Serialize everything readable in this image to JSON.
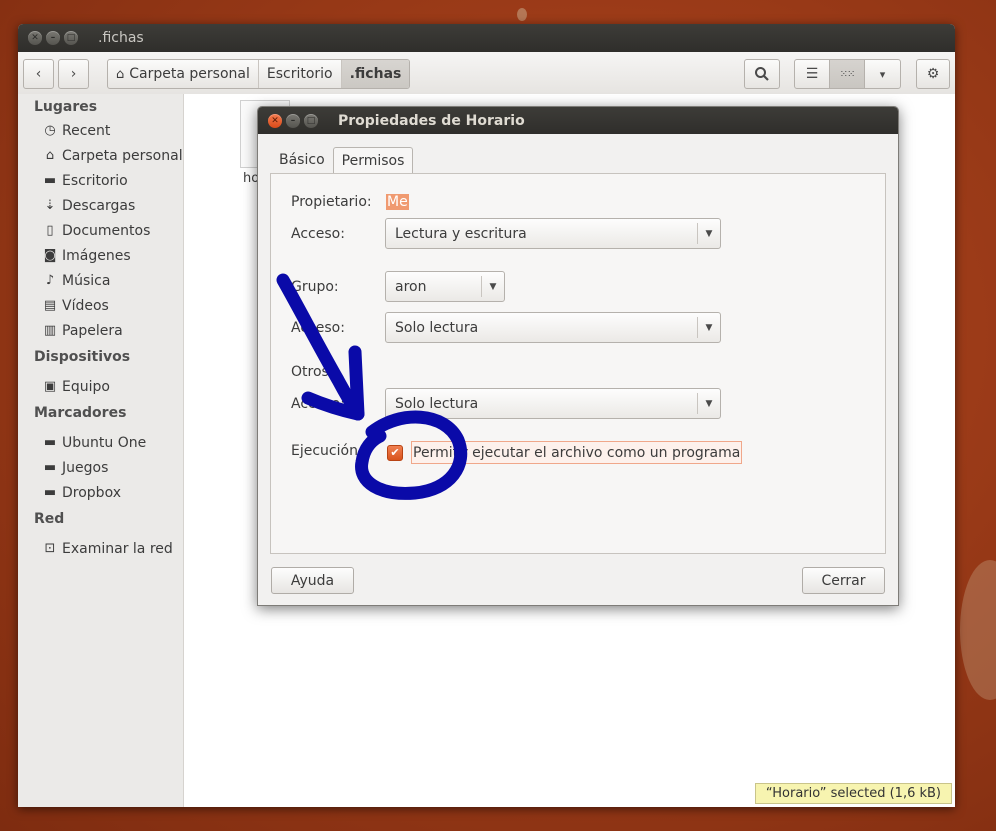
{
  "window": {
    "title": ".fichas"
  },
  "toolbar": {
    "back_icon": "chevron-left-icon",
    "forward_icon": "chevron-right-icon",
    "breadcrumbs": [
      {
        "label": "Carpeta personal",
        "icon": "home-icon"
      },
      {
        "label": "Escritorio"
      },
      {
        "label": ".fichas",
        "active": true
      }
    ],
    "search_icon": "search-icon",
    "list_view_icon": "list-view-icon",
    "grid_view_icon": "grid-view-icon",
    "view_menu_icon": "chevron-down-icon",
    "settings_icon": "gear-icon"
  },
  "sidebar": {
    "places": {
      "heading": "Lugares",
      "items": [
        {
          "label": "Recent",
          "icon": "clock-icon"
        },
        {
          "label": "Carpeta personal",
          "icon": "home-icon"
        },
        {
          "label": "Escritorio",
          "icon": "folder-icon"
        },
        {
          "label": "Descargas",
          "icon": "download-icon"
        },
        {
          "label": "Documentos",
          "icon": "document-icon"
        },
        {
          "label": "Imágenes",
          "icon": "camera-icon"
        },
        {
          "label": "Música",
          "icon": "music-icon"
        },
        {
          "label": "Vídeos",
          "icon": "film-icon"
        },
        {
          "label": "Papelera",
          "icon": "trash-icon"
        }
      ]
    },
    "devices": {
      "heading": "Dispositivos",
      "items": [
        {
          "label": "Equipo",
          "icon": "computer-icon"
        }
      ]
    },
    "bookmarks": {
      "heading": "Marcadores",
      "items": [
        {
          "label": "Ubuntu One",
          "icon": "folder-icon"
        },
        {
          "label": "Juegos",
          "icon": "folder-icon"
        },
        {
          "label": "Dropbox",
          "icon": "folder-icon"
        }
      ]
    },
    "network": {
      "heading": "Red",
      "items": [
        {
          "label": "Examinar la red",
          "icon": "network-icon"
        }
      ]
    }
  },
  "content": {
    "file_label_partial": "ho"
  },
  "status": "“Horario” selected  (1,6 kB)",
  "dialog": {
    "title": "Propiedades de Horario",
    "tabs": [
      {
        "label": "Básico"
      },
      {
        "label": "Permisos",
        "active": true
      }
    ],
    "owner_label": "Propietario:",
    "owner_value": "Me",
    "owner_access_label": "Acceso:",
    "owner_access_value": "Lectura y escritura",
    "group_label": "Grupo:",
    "group_value": "aron",
    "group_access_label": "Acceso:",
    "group_access_value": "Solo lectura",
    "others_label": "Otros",
    "others_access_label": "Acceso:",
    "others_access_value": "Solo lectura",
    "execute_label": "Ejecución:",
    "execute_checkbox_label": "Permitir ejecutar el archivo como un programa",
    "execute_checked": true,
    "help_button": "Ayuda",
    "close_button": "Cerrar"
  },
  "colors": {
    "accent": "#dd4814",
    "annotation": "#0a0aa8",
    "titlebar": "#3c3b37"
  }
}
